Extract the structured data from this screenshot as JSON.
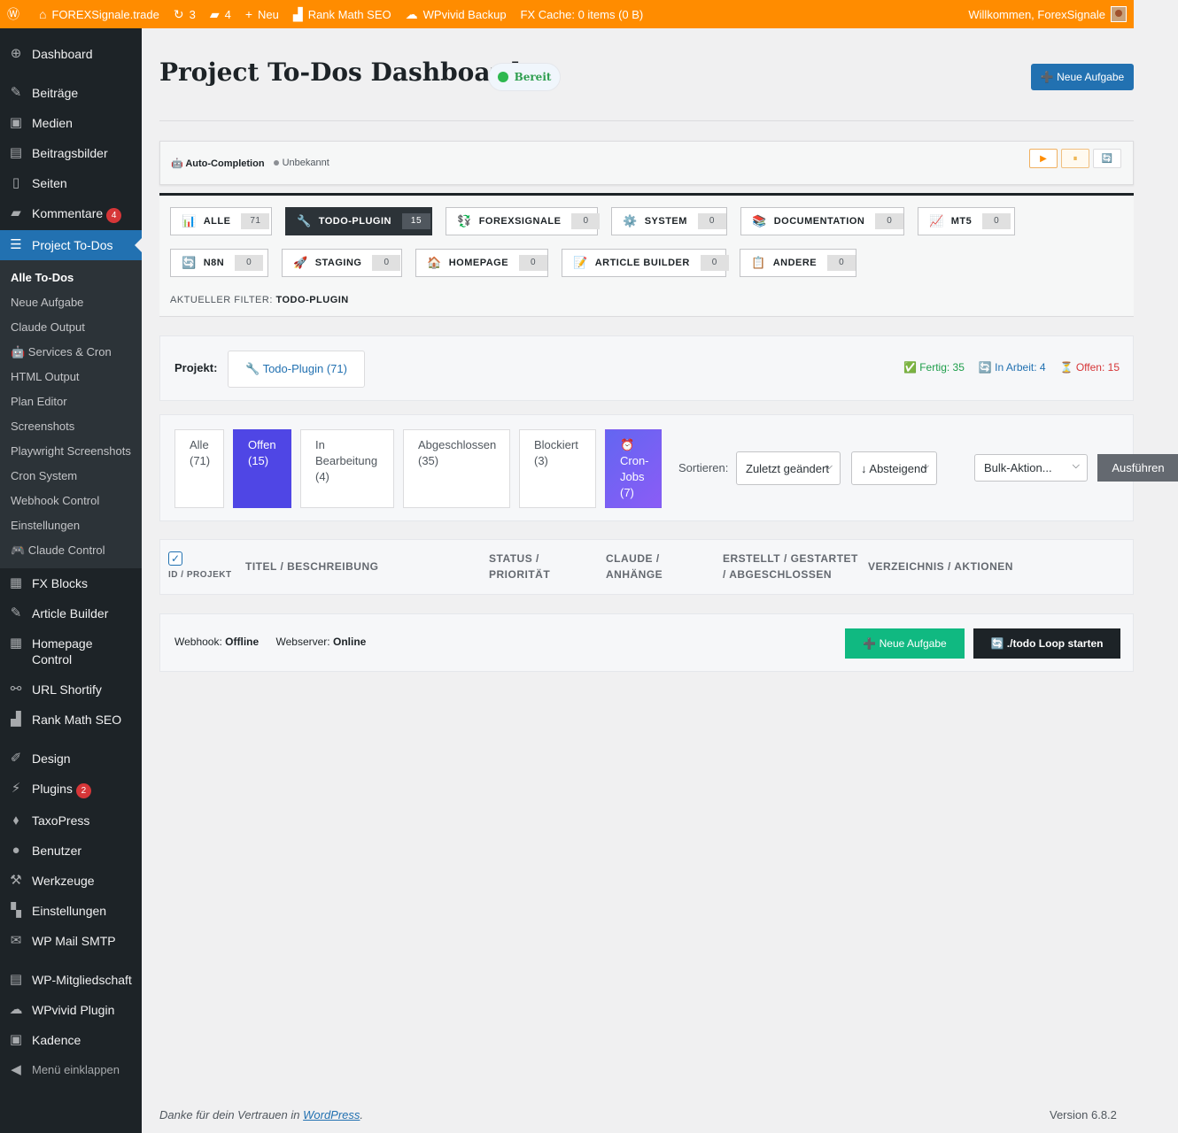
{
  "adminbar": {
    "site": "FOREXSignale.trade",
    "updates": "3",
    "comments": "4",
    "new": "Neu",
    "rankmath": "Rank Math SEO",
    "wpvivid": "WPvivid Backup",
    "fxcache": "FX Cache: 0 items (0 B)",
    "welcome": "Willkommen, ForexSignale"
  },
  "sidebar": {
    "items_top": [
      {
        "label": "Dashboard",
        "icon": "⊕"
      },
      {
        "label": "Beiträge",
        "icon": "✎"
      },
      {
        "label": "Medien",
        "icon": "▣"
      },
      {
        "label": "Beitragsbilder",
        "icon": "▤"
      },
      {
        "label": "Seiten",
        "icon": "▯"
      },
      {
        "label": "Kommentare",
        "icon": "▰",
        "badge": "4"
      },
      {
        "label": "Project To-Dos",
        "icon": "☰"
      }
    ],
    "submenu": [
      "Alle To-Dos",
      "Neue Aufgabe",
      "Claude Output",
      "🤖 Services & Cron",
      "HTML Output",
      "Plan Editor",
      "Screenshots",
      "Playwright Screenshots",
      "Cron System",
      "Webhook Control",
      "Einstellungen",
      "🎮 Claude Control"
    ],
    "items_mid": [
      {
        "label": "FX Blocks",
        "icon": "▦"
      },
      {
        "label": "Article Builder",
        "icon": "✎"
      },
      {
        "label": "Homepage Control",
        "icon": "▦"
      },
      {
        "label": "URL Shortify",
        "icon": "⚯"
      },
      {
        "label": "Rank Math SEO",
        "icon": "▟"
      }
    ],
    "items_bottom": [
      {
        "label": "Design",
        "icon": "✐"
      },
      {
        "label": "Plugins",
        "icon": "⚡",
        "badge": "2"
      },
      {
        "label": "TaxoPress",
        "icon": "⬧"
      },
      {
        "label": "Benutzer",
        "icon": "●"
      },
      {
        "label": "Werkzeuge",
        "icon": "⚒"
      },
      {
        "label": "Einstellungen",
        "icon": "▚"
      },
      {
        "label": "WP Mail SMTP",
        "icon": "✉"
      }
    ],
    "items_last": [
      {
        "label": "WP-Mitgliedschaft",
        "icon": "▤"
      },
      {
        "label": "WPvivid Plugin",
        "icon": "☁"
      },
      {
        "label": "Kadence",
        "icon": "▣"
      }
    ],
    "collapse": "Menü einklappen"
  },
  "page": {
    "title": "Project To-Dos Dashboard",
    "status_pill": "Bereit",
    "new_task": "➕ Neue Aufgabe"
  },
  "auto": {
    "label": "🤖 Auto-Completion",
    "status": "Unbekannt",
    "btn_play": "▶",
    "btn_pause": "⏸",
    "btn_refresh": "🔄"
  },
  "categories": [
    {
      "icon": "📊",
      "label": "ALLE",
      "count": "71"
    },
    {
      "icon": "🔧",
      "label": "TODO-PLUGIN",
      "count": "15"
    },
    {
      "icon": "💱",
      "label": "FOREXSIGNALE",
      "count": "0"
    },
    {
      "icon": "⚙️",
      "label": "SYSTEM",
      "count": "0"
    },
    {
      "icon": "📚",
      "label": "DOCUMENTATION",
      "count": "0"
    },
    {
      "icon": "📈",
      "label": "MT5",
      "count": "0"
    },
    {
      "icon": "🔄",
      "label": "N8N",
      "count": "0"
    },
    {
      "icon": "🚀",
      "label": "STAGING",
      "count": "0"
    },
    {
      "icon": "🏠",
      "label": "HOMEPAGE",
      "count": "0"
    },
    {
      "icon": "📝",
      "label": "ARTICLE BUILDER",
      "count": "0"
    },
    {
      "icon": "📋",
      "label": "ANDERE",
      "count": "0"
    }
  ],
  "filter": {
    "label": "AKTUELLER FILTER:",
    "value": "TODO-PLUGIN"
  },
  "project": {
    "label": "Projekt:",
    "selected": "🔧 Todo-Plugin (71)",
    "done": "✅ Fertig: 35",
    "inprogress": "🔄 In Arbeit: 4",
    "open": "⏳ Offen: 15"
  },
  "status_filters": [
    {
      "label": "Alle",
      "count": "(71)"
    },
    {
      "label": "Offen",
      "count": "(15)"
    },
    {
      "label": "In Bearbeitung",
      "count": "(4)"
    },
    {
      "label": "Abgeschlossen",
      "count": "(35)"
    },
    {
      "label": "Blockiert",
      "count": "(3)"
    },
    {
      "label": "⏰ Cron-Jobs",
      "count": "(7)"
    }
  ],
  "sort": {
    "label": "Sortieren:",
    "by": "Zuletzt geändert",
    "dir": "↓ Absteigend",
    "bulk": "Bulk-Aktion...",
    "apply": "Ausführen"
  },
  "table": {
    "col_id": "ID / PROJEKT",
    "col_title": "TITEL / BESCHREIBUNG",
    "col_status": "STATUS / PRIORITÄT",
    "col_claude": "CLAUDE / ANHÄNGE",
    "col_dates": "ERSTELLT / GESTARTET / ABGESCHLOSSEN",
    "col_dir": "VERZEICHNIS / AKTIONEN"
  },
  "footer_box": {
    "webhook_label": "Webhook:",
    "webhook_value": "Offline",
    "server_label": "Webserver:",
    "server_value": "Online",
    "new_task": "➕ Neue Aufgabe",
    "loop": "🔄 ./todo Loop starten"
  },
  "wp_footer": {
    "thanks": "Danke für dein Vertrauen in ",
    "wp": "WordPress",
    "version": "Version 6.8.2"
  },
  "colors": {
    "adminbar": "#ff8c00",
    "accent": "#2271b1",
    "sidebar": "#1d2327",
    "offen": "#4f46e5",
    "green": "#10b981"
  }
}
